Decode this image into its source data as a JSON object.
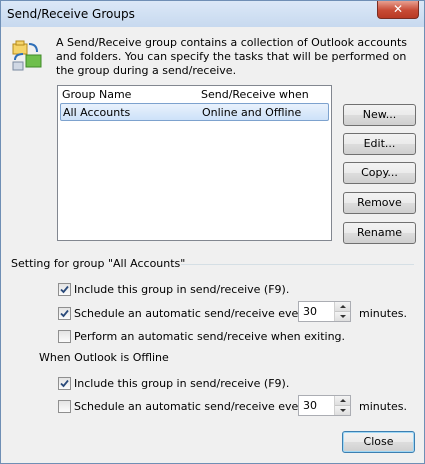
{
  "window": {
    "title": "Send/Receive Groups",
    "close_glyph": "✕"
  },
  "intro": {
    "text": "A Send/Receive group contains a collection of Outlook accounts and folders. You can specify the tasks that will be performed on the group during a send/receive.",
    "icon": "send-receive-groups-icon"
  },
  "list": {
    "col_name": "Group Name",
    "col_when": "Send/Receive when",
    "rows": [
      {
        "name": "All Accounts",
        "when": "Online and Offline"
      }
    ]
  },
  "buttons": {
    "new": "New...",
    "edit": "Edit...",
    "copy": "Copy...",
    "remove": "Remove",
    "rename": "Rename",
    "close": "Close"
  },
  "setting": {
    "title": "Setting for group \"All Accounts\"",
    "online": {
      "include": {
        "label": "Include this group in send/receive (F9).",
        "checked": true
      },
      "schedule": {
        "label": "Schedule an automatic send/receive every",
        "checked": true,
        "minutes": "30",
        "unit": "minutes."
      },
      "exit": {
        "label": "Perform an automatic send/receive when exiting.",
        "checked": false
      }
    },
    "offline_title": "When Outlook is Offline",
    "offline": {
      "include": {
        "label": "Include this group in send/receive (F9).",
        "checked": true
      },
      "schedule": {
        "label": "Schedule an automatic send/receive every",
        "checked": false,
        "minutes": "30",
        "unit": "minutes."
      }
    }
  },
  "colors": {
    "selection": "#cde2f9",
    "accent": "#3c7fb1",
    "titlebar": "#c7d9ef"
  }
}
